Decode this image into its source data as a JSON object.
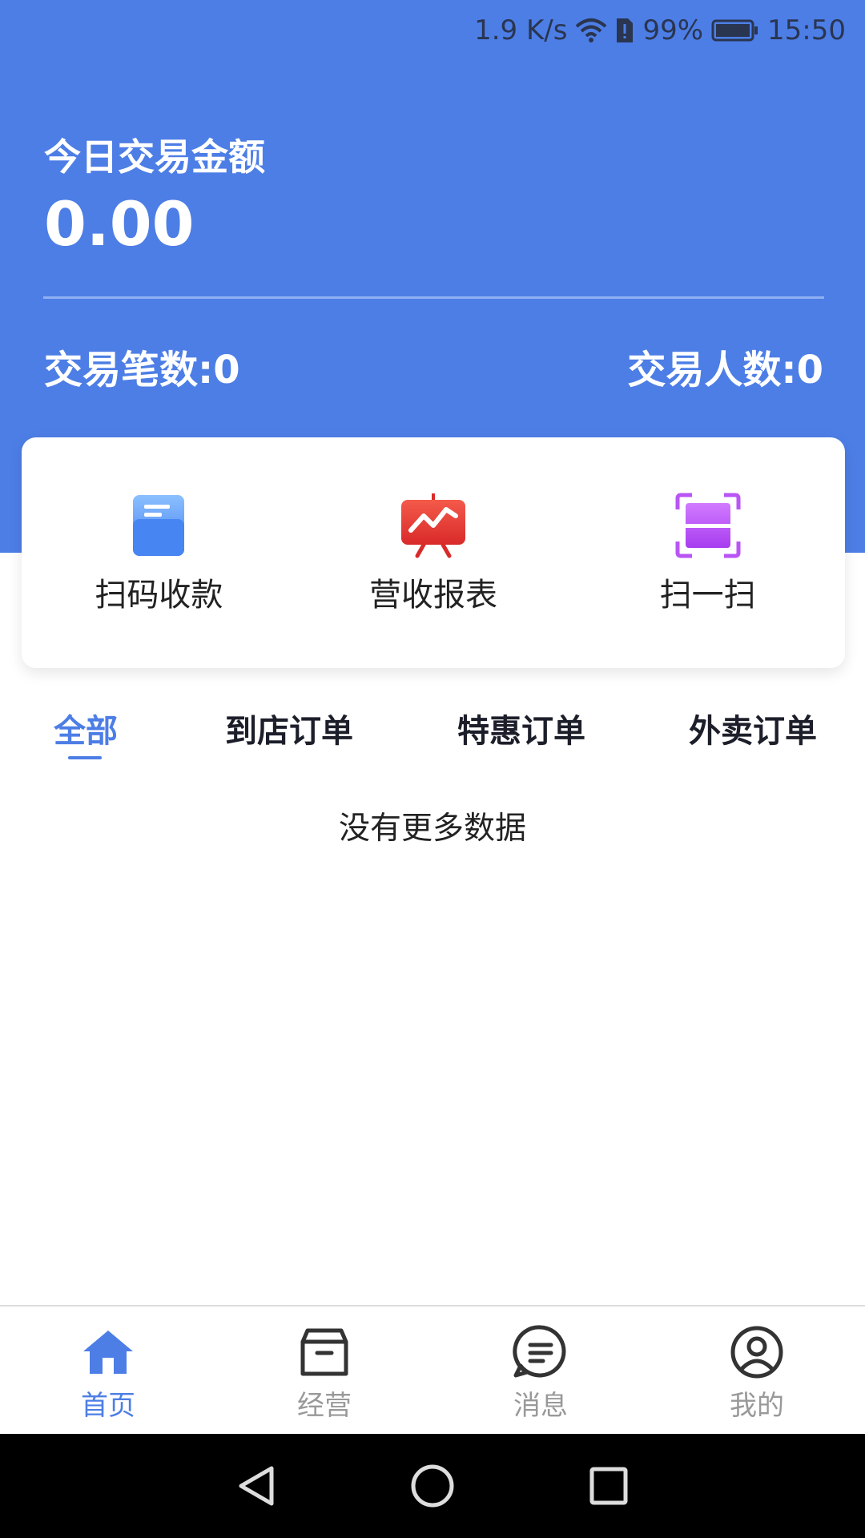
{
  "status_bar": {
    "speed": "1.9 K/s",
    "battery": "99%",
    "time": "15:50",
    "icons": [
      "wifi-icon",
      "sim-alert-icon",
      "battery-icon"
    ]
  },
  "header": {
    "title": "今日交易金额",
    "amount": "0.00",
    "transactions_label": "交易笔数:0",
    "customers_label": "交易人数:0",
    "accent_color": "#4d7ee6"
  },
  "quick_actions": [
    {
      "label": "扫码收款",
      "icon": "scan-receive-icon"
    },
    {
      "label": "营收报表",
      "icon": "revenue-chart-icon"
    },
    {
      "label": "扫一扫",
      "icon": "scan-icon"
    }
  ],
  "tabs": [
    {
      "label": "全部",
      "active": true
    },
    {
      "label": "到店订单",
      "active": false
    },
    {
      "label": "特惠订单",
      "active": false
    },
    {
      "label": "外卖订单",
      "active": false
    }
  ],
  "empty_message": "没有更多数据",
  "bottom_nav": [
    {
      "label": "首页",
      "icon": "home-icon",
      "active": true
    },
    {
      "label": "经营",
      "icon": "box-icon",
      "active": false
    },
    {
      "label": "消息",
      "icon": "message-icon",
      "active": false
    },
    {
      "label": "我的",
      "icon": "profile-icon",
      "active": false
    }
  ],
  "system_nav": [
    "back-icon",
    "home-circle-icon",
    "recents-icon"
  ]
}
